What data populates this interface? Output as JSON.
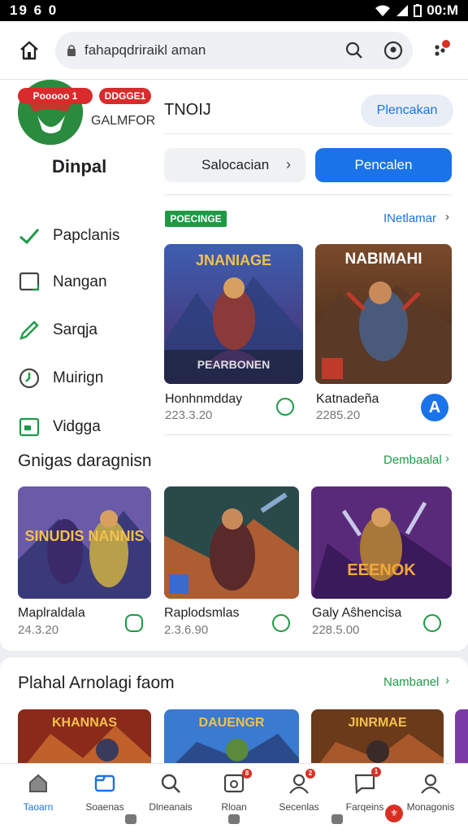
{
  "status_bar": {
    "time": "19 6 0",
    "right_text": "00:M"
  },
  "browser": {
    "url": "fahapqdriraikl aman"
  },
  "drawer": {
    "badge_left": "Pooooo 1",
    "badge_right": "DDGGE1",
    "subtitle": "GALMFOR",
    "title": "Dinpal",
    "items": [
      {
        "label": "Papclanis",
        "icon": "check-icon"
      },
      {
        "label": "Nangan",
        "icon": "square-icon"
      },
      {
        "label": "Sarqja",
        "icon": "pencil-icon"
      },
      {
        "label": "Muirign",
        "icon": "clock-icon"
      },
      {
        "label": "Vidgga",
        "icon": "folder-icon"
      }
    ]
  },
  "main": {
    "heading": "TNOIJ",
    "heading_button": "Plencakan",
    "outline_button": "Salocacian",
    "primary_button": "Pencalen",
    "badge": "POECINGE",
    "see_all": "INetlamar",
    "featured": [
      {
        "art": "JNANIAGE",
        "footer": "PEARBONEN",
        "title": "Honhnmdday",
        "sub": "223.3.20"
      },
      {
        "art": "NABIMAHI",
        "footer": "",
        "title": "Katnadeña",
        "sub": "2285.20",
        "action": "A"
      }
    ]
  },
  "section2": {
    "title": "Gnigas daragnisn",
    "see_all": "Dembaalal",
    "tiles": [
      {
        "art": "SINUDIS NANNIS",
        "title": "Maplraldala",
        "sub": "24.3.20"
      },
      {
        "art": "",
        "title": "Raplodsmlas",
        "sub": "2.3.6.90"
      },
      {
        "art": "EEENOK",
        "title": "Galy Aŝhencisa",
        "sub": "228.5.00"
      }
    ]
  },
  "section3": {
    "title": "Plahal Arnolagi faom",
    "see_all": "Nambanel",
    "tiles": [
      {
        "art": "KHANNAS"
      },
      {
        "art": "DAUENGR"
      },
      {
        "art": "JINRMAE"
      }
    ]
  },
  "bottom_nav": [
    {
      "label": "Taoarn",
      "icon": "home-icon",
      "active": true
    },
    {
      "label": "Soaenas",
      "icon": "apps-icon"
    },
    {
      "label": "Dlneanais",
      "icon": "search-icon"
    },
    {
      "label": "Rloan",
      "icon": "library-icon",
      "badge": true
    },
    {
      "label": "Secenlas",
      "icon": "person-icon",
      "badge": true
    },
    {
      "label": "Farqeins",
      "icon": "chat-icon",
      "badge": true
    },
    {
      "label": "Monagonis",
      "icon": "account-icon"
    }
  ],
  "colors": {
    "accent": "#1a73e8",
    "green": "#1e9a45",
    "red": "#d93025"
  }
}
